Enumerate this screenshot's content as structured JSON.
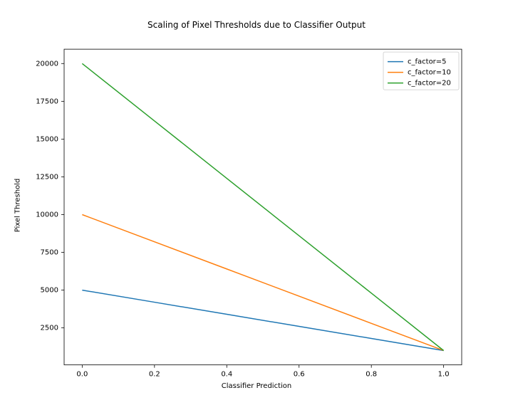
{
  "chart_data": {
    "type": "line",
    "title": "Scaling of Pixel Thresholds due to Classifier Output",
    "xlabel": "Classifier Prediction",
    "ylabel": "Pixel Threshold",
    "xlim": [
      -0.05,
      1.05
    ],
    "ylim": [
      50,
      20950
    ],
    "x_ticks": [
      0.0,
      0.2,
      0.4,
      0.6,
      0.8,
      1.0
    ],
    "y_ticks": [
      2500,
      5000,
      7500,
      10000,
      12500,
      15000,
      17500,
      20000
    ],
    "x": [
      0.0,
      0.2,
      0.4,
      0.6,
      0.8,
      1.0
    ],
    "series": [
      {
        "name": "c_factor=5",
        "color": "#1f77b4",
        "values": [
          5000,
          4200,
          3400,
          2600,
          1800,
          1000
        ]
      },
      {
        "name": "c_factor=10",
        "color": "#ff7f0e",
        "values": [
          10000,
          8200,
          6400,
          4600,
          2800,
          1000
        ]
      },
      {
        "name": "c_factor=20",
        "color": "#2ca02c",
        "values": [
          20000,
          16200,
          12400,
          8600,
          4800,
          1000
        ]
      }
    ],
    "legend_position": "upper right"
  }
}
